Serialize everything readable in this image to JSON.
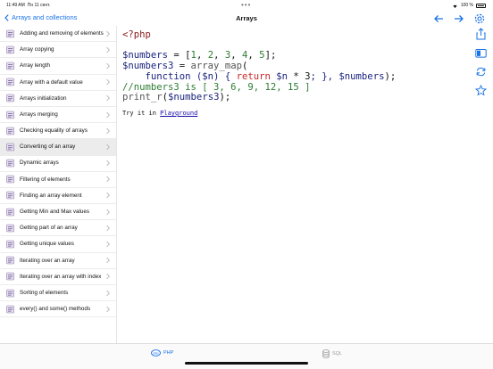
{
  "status": {
    "time": "11:49 AM",
    "date": "Пн 11 сент.",
    "battery": "100 %"
  },
  "nav": {
    "back_label": "Arrays and collections",
    "title": "Arrays"
  },
  "sidebar": {
    "items": [
      {
        "label": "Adding and removing of elements"
      },
      {
        "label": "Array copying"
      },
      {
        "label": "Array length"
      },
      {
        "label": "Array with a default value"
      },
      {
        "label": "Arrays initialization"
      },
      {
        "label": "Arrays merging"
      },
      {
        "label": "Checking equality of arrays"
      },
      {
        "label": "Converting of an array"
      },
      {
        "label": "Dynamic arrays"
      },
      {
        "label": "Filtering of elements"
      },
      {
        "label": "Finding an array element"
      },
      {
        "label": "Getting Min and Max values"
      },
      {
        "label": "Getting part of an array"
      },
      {
        "label": "Getting unique values"
      },
      {
        "label": "Iterating over an array"
      },
      {
        "label": "Iterating over an array with index"
      },
      {
        "label": "Sorting of elements"
      },
      {
        "label": "every() and some() methods"
      }
    ],
    "selected_index": 7
  },
  "code": {
    "open_tag": "<?php",
    "line1": {
      "var": "$numbers",
      "eq": " = [",
      "n1": "1",
      "n2": "2",
      "n3": "3",
      "n4": "4",
      "n5": "5",
      "end": "];"
    },
    "line2": {
      "var": "$numbers3",
      "eq": " = ",
      "fn": "array_map",
      "open": "("
    },
    "line3": {
      "indent": "    ",
      "kw1": "function",
      "args": " ($n) { ",
      "kw2": "return",
      "expr_var": " $n",
      "expr": " * ",
      "num": "3",
      "end": "; }, ",
      "var": "$numbers",
      "close": ");"
    },
    "line4": {
      "comment": "//numbers3 is [ 3, 6, 9, 12, 15 ]"
    },
    "line5": {
      "fn": "print_r",
      "open": "(",
      "var": "$numbers3",
      "close": ");"
    }
  },
  "tryit": {
    "prefix": "Try it in ",
    "link": "Playground"
  },
  "tabs": {
    "php": "PHP",
    "sql": "SQL"
  },
  "colors": {
    "accent": "#1a73e8",
    "selected_row": "#ececec"
  }
}
